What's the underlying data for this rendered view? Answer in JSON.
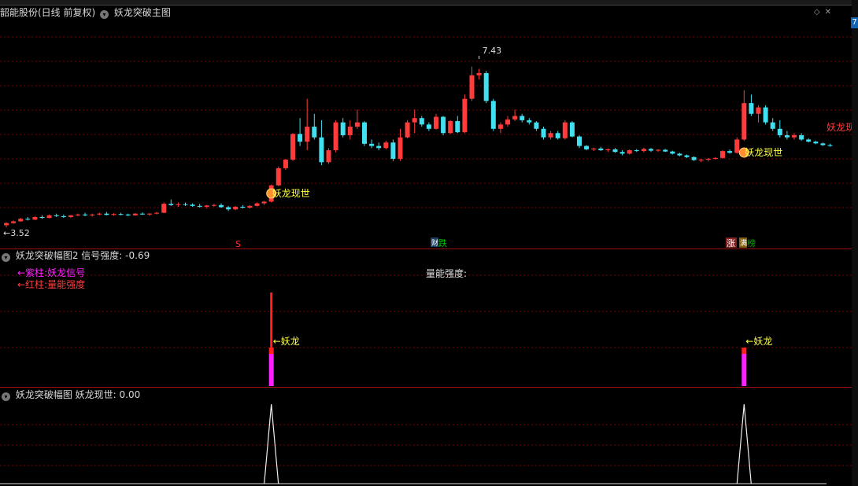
{
  "main_panel": {
    "stock_label": "韶能股份(日线 前复权)",
    "indicator_name": "妖龙突破主图",
    "high_label": "7.43",
    "low_label": "3.52",
    "signal_text": "妖龙现世",
    "edge_text": "妖龙现",
    "markers": [
      {
        "text": "S",
        "color": "#ff3030"
      },
      {
        "text": "跌",
        "color": "#00c000"
      },
      {
        "text": "涨",
        "color": "#ff3030"
      },
      {
        "text": "榜",
        "color": "#00a000"
      }
    ],
    "small_badges": [
      "财",
      "涨",
      "满"
    ]
  },
  "panel2": {
    "name": "妖龙突破幅图2",
    "field_label": "信号强度:",
    "field_value": "-0.69",
    "legend_purple": "←紫柱:妖龙信号",
    "legend_red": "←红柱:量能强度",
    "center_label": "量能强度:",
    "signal_label": "←妖龙"
  },
  "panel3": {
    "name": "妖龙突破幅图",
    "field_label": "妖龙现世:",
    "field_value": "0.00"
  },
  "right_controls": {
    "diamond": "◇",
    "close": "✕",
    "box_label": "7"
  },
  "colors": {
    "up": "#ff3b3b",
    "down": "#40e0f0",
    "signal_yellow": "#ffff40",
    "purple": "#ff20ff",
    "grid": "#7a0000"
  },
  "chart_data": {
    "type": "candlestick",
    "price_high": 7.43,
    "price_low": 3.52,
    "candles": [
      [
        3.55,
        3.62,
        3.5,
        3.6
      ],
      [
        3.6,
        3.66,
        3.58,
        3.64
      ],
      [
        3.64,
        3.72,
        3.63,
        3.7
      ],
      [
        3.7,
        3.74,
        3.66,
        3.68
      ],
      [
        3.68,
        3.76,
        3.67,
        3.74
      ],
      [
        3.74,
        3.78,
        3.7,
        3.72
      ],
      [
        3.72,
        3.8,
        3.71,
        3.78
      ],
      [
        3.78,
        3.82,
        3.74,
        3.76
      ],
      [
        3.76,
        3.8,
        3.72,
        3.74
      ],
      [
        3.74,
        3.79,
        3.72,
        3.78
      ],
      [
        3.78,
        3.82,
        3.76,
        3.8
      ],
      [
        3.8,
        3.84,
        3.76,
        3.78
      ],
      [
        3.78,
        3.82,
        3.75,
        3.8
      ],
      [
        3.8,
        3.84,
        3.78,
        3.82
      ],
      [
        3.82,
        3.86,
        3.78,
        3.79
      ],
      [
        3.79,
        3.83,
        3.77,
        3.81
      ],
      [
        3.81,
        3.84,
        3.78,
        3.8
      ],
      [
        3.8,
        3.82,
        3.76,
        3.78
      ],
      [
        3.78,
        3.83,
        3.77,
        3.82
      ],
      [
        3.82,
        3.85,
        3.79,
        3.8
      ],
      [
        3.8,
        3.83,
        3.77,
        3.82
      ],
      [
        3.82,
        3.86,
        3.8,
        3.84
      ],
      [
        3.84,
        4.08,
        3.83,
        4.05
      ],
      [
        4.05,
        4.15,
        4.0,
        4.02
      ],
      [
        4.02,
        4.08,
        3.98,
        4.04
      ],
      [
        4.04,
        4.08,
        4.0,
        4.03
      ],
      [
        4.03,
        4.06,
        3.98,
        4.0
      ],
      [
        4.0,
        4.05,
        3.96,
        3.98
      ],
      [
        3.98,
        4.02,
        3.94,
        4.01
      ],
      [
        4.01,
        4.05,
        3.98,
        4.02
      ],
      [
        4.02,
        4.06,
        3.96,
        3.97
      ],
      [
        3.97,
        4.0,
        3.88,
        3.92
      ],
      [
        3.92,
        4.0,
        3.9,
        3.98
      ],
      [
        3.98,
        4.02,
        3.94,
        3.96
      ],
      [
        3.96,
        4.02,
        3.94,
        4.0
      ],
      [
        4.0,
        4.08,
        3.99,
        4.06
      ],
      [
        4.06,
        4.12,
        4.02,
        4.1
      ],
      [
        4.1,
        4.5,
        4.08,
        4.48
      ],
      [
        4.48,
        4.92,
        4.46,
        4.88
      ],
      [
        4.88,
        5.1,
        4.84,
        5.08
      ],
      [
        5.08,
        5.7,
        5.05,
        5.68
      ],
      [
        5.68,
        6.05,
        5.4,
        5.5
      ],
      [
        5.5,
        6.5,
        5.3,
        5.85
      ],
      [
        5.85,
        6.15,
        5.55,
        5.6
      ],
      [
        5.6,
        6.0,
        4.95,
        5.02
      ],
      [
        5.02,
        5.35,
        4.98,
        5.3
      ],
      [
        5.3,
        6.0,
        5.25,
        5.95
      ],
      [
        5.95,
        6.05,
        5.6,
        5.65
      ],
      [
        5.65,
        6.0,
        5.55,
        5.85
      ],
      [
        5.85,
        6.25,
        5.8,
        5.95
      ],
      [
        5.95,
        5.98,
        5.4,
        5.45
      ],
      [
        5.45,
        5.55,
        5.35,
        5.4
      ],
      [
        5.4,
        5.48,
        5.3,
        5.35
      ],
      [
        5.35,
        5.52,
        5.32,
        5.48
      ],
      [
        5.48,
        5.55,
        5.05,
        5.1
      ],
      [
        5.1,
        5.8,
        5.05,
        5.6
      ],
      [
        5.6,
        6.0,
        5.58,
        5.95
      ],
      [
        5.95,
        6.25,
        5.7,
        6.05
      ],
      [
        6.05,
        6.1,
        5.85,
        5.9
      ],
      [
        5.9,
        5.95,
        5.75,
        5.8
      ],
      [
        5.8,
        6.15,
        5.78,
        6.08
      ],
      [
        6.08,
        6.1,
        5.65,
        5.7
      ],
      [
        5.7,
        6.0,
        5.68,
        5.98
      ],
      [
        5.98,
        6.1,
        5.7,
        5.72
      ],
      [
        5.72,
        6.6,
        5.7,
        6.5
      ],
      [
        6.5,
        7.25,
        6.45,
        7.05
      ],
      [
        7.05,
        7.2,
        6.95,
        7.1
      ],
      [
        7.1,
        7.15,
        6.4,
        6.45
      ],
      [
        6.45,
        6.5,
        5.75,
        5.8
      ],
      [
        5.8,
        5.95,
        5.7,
        5.9
      ],
      [
        5.9,
        6.1,
        5.85,
        6.02
      ],
      [
        6.02,
        6.25,
        5.98,
        6.1
      ],
      [
        6.1,
        6.15,
        5.95,
        6.0
      ],
      [
        6.0,
        6.05,
        5.9,
        5.95
      ],
      [
        5.95,
        5.98,
        5.75,
        5.8
      ],
      [
        5.8,
        5.85,
        5.55,
        5.6
      ],
      [
        5.6,
        5.75,
        5.55,
        5.7
      ],
      [
        5.7,
        5.75,
        5.55,
        5.58
      ],
      [
        5.58,
        6.0,
        5.55,
        5.95
      ],
      [
        5.95,
        5.98,
        5.6,
        5.62
      ],
      [
        5.62,
        5.65,
        5.35,
        5.4
      ],
      [
        5.4,
        5.42,
        5.3,
        5.32
      ],
      [
        5.32,
        5.36,
        5.28,
        5.34
      ],
      [
        5.34,
        5.38,
        5.28,
        5.3
      ],
      [
        5.3,
        5.34,
        5.26,
        5.32
      ],
      [
        5.32,
        5.35,
        5.24,
        5.26
      ],
      [
        5.26,
        5.3,
        5.18,
        5.22
      ],
      [
        5.22,
        5.32,
        5.2,
        5.3
      ],
      [
        5.3,
        5.33,
        5.26,
        5.28
      ],
      [
        5.28,
        5.36,
        5.25,
        5.33
      ],
      [
        5.33,
        5.35,
        5.26,
        5.29
      ],
      [
        5.29,
        5.32,
        5.26,
        5.31
      ],
      [
        5.31,
        5.33,
        5.26,
        5.27
      ],
      [
        5.27,
        5.29,
        5.2,
        5.22
      ],
      [
        5.22,
        5.24,
        5.16,
        5.18
      ],
      [
        5.18,
        5.2,
        5.12,
        5.14
      ],
      [
        5.14,
        5.16,
        5.05,
        5.07
      ],
      [
        5.07,
        5.1,
        5.02,
        5.08
      ],
      [
        5.08,
        5.12,
        5.04,
        5.1
      ],
      [
        5.1,
        5.14,
        5.08,
        5.12
      ],
      [
        5.12,
        5.3,
        5.1,
        5.28
      ],
      [
        5.28,
        5.32,
        5.22,
        5.24
      ],
      [
        5.24,
        5.6,
        5.22,
        5.55
      ],
      [
        5.55,
        6.7,
        5.52,
        6.4
      ],
      [
        6.4,
        6.6,
        6.1,
        6.15
      ],
      [
        6.15,
        6.35,
        5.95,
        6.3
      ],
      [
        6.3,
        6.35,
        5.9,
        5.95
      ],
      [
        5.95,
        6.05,
        5.75,
        5.8
      ],
      [
        5.8,
        6.0,
        5.6,
        5.65
      ],
      [
        5.65,
        5.75,
        5.55,
        5.6
      ],
      [
        5.6,
        5.7,
        5.55,
        5.65
      ],
      [
        5.65,
        5.7,
        5.52,
        5.55
      ],
      [
        5.55,
        5.58,
        5.48,
        5.5
      ],
      [
        5.5,
        5.52,
        5.44,
        5.46
      ],
      [
        5.46,
        5.48,
        5.4,
        5.42
      ],
      [
        5.42,
        5.45,
        5.38,
        5.4
      ]
    ],
    "signal_bars_index": [
      37,
      103
    ],
    "signal_strength": -0.69,
    "yaolong_value": 0.0
  }
}
